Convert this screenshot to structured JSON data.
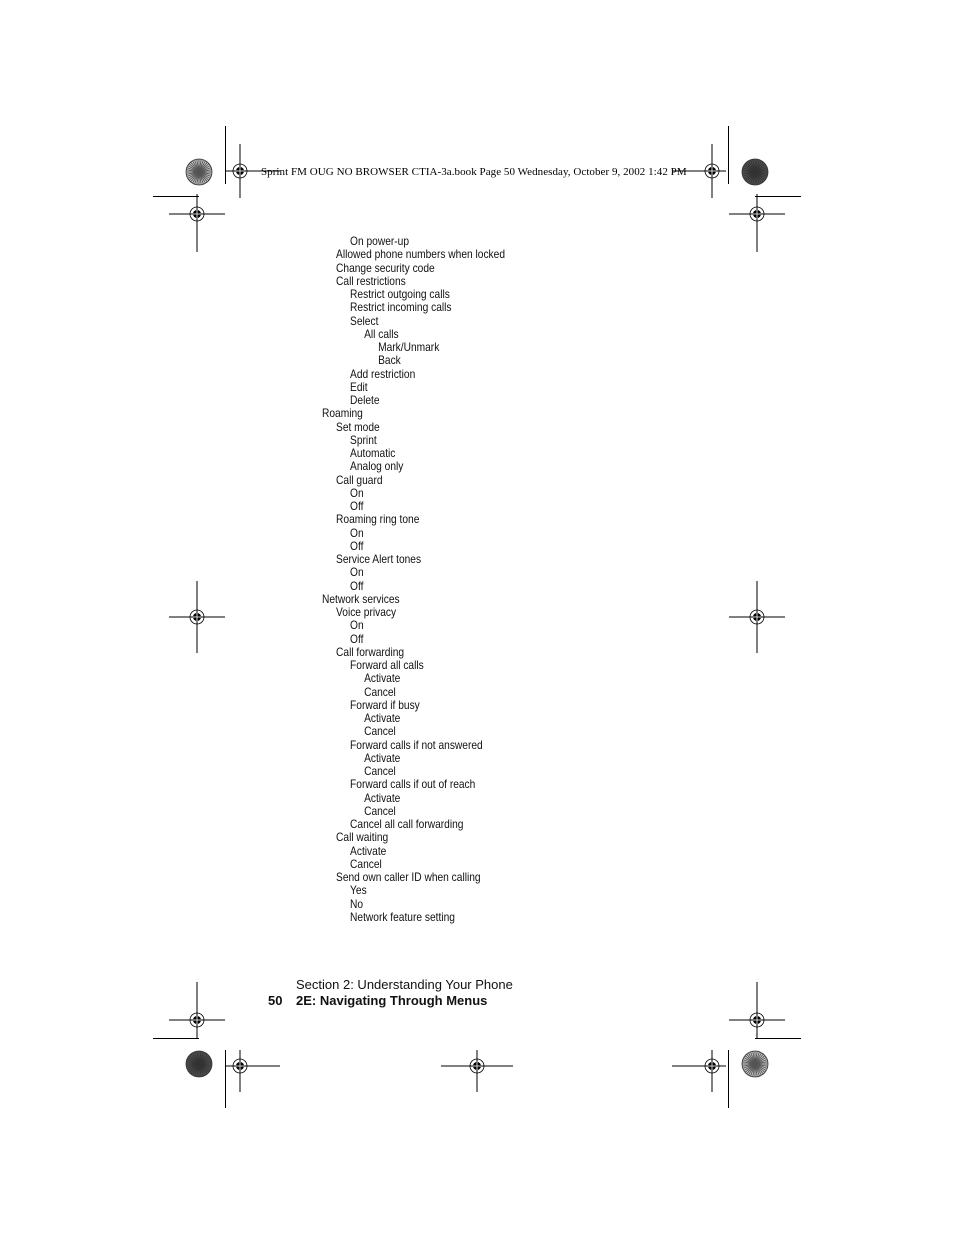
{
  "header": {
    "slug": "Sprint FM OUG NO BROWSER CTIA-3a.book  Page 50  Wednesday, October 9, 2002  1:42 PM"
  },
  "menu": [
    {
      "label": "On power-up",
      "level": 2
    },
    {
      "label": "Allowed phone numbers when locked",
      "level": 1
    },
    {
      "label": "Change security code",
      "level": 1
    },
    {
      "label": "Call restrictions",
      "level": 1
    },
    {
      "label": "Restrict outgoing calls",
      "level": 2
    },
    {
      "label": "Restrict incoming calls",
      "level": 2
    },
    {
      "label": "Select",
      "level": 2
    },
    {
      "label": "All calls",
      "level": 3
    },
    {
      "label": "Mark/Unmark",
      "level": 4
    },
    {
      "label": "Back",
      "level": 4
    },
    {
      "label": "Add restriction",
      "level": 2
    },
    {
      "label": "Edit",
      "level": 2
    },
    {
      "label": "Delete",
      "level": 2
    },
    {
      "label": "Roaming",
      "level": 0
    },
    {
      "label": "Set mode",
      "level": 1
    },
    {
      "label": "Sprint",
      "level": 2
    },
    {
      "label": "Automatic",
      "level": 2
    },
    {
      "label": "Analog only",
      "level": 2
    },
    {
      "label": "Call guard",
      "level": 1
    },
    {
      "label": "On",
      "level": 2
    },
    {
      "label": "Off",
      "level": 2
    },
    {
      "label": "Roaming ring tone",
      "level": 1
    },
    {
      "label": "On",
      "level": 2
    },
    {
      "label": "Off",
      "level": 2
    },
    {
      "label": "Service Alert tones",
      "level": 1
    },
    {
      "label": "On",
      "level": 2
    },
    {
      "label": "Off",
      "level": 2
    },
    {
      "label": "Network services",
      "level": 0
    },
    {
      "label": "Voice privacy",
      "level": 1
    },
    {
      "label": "On",
      "level": 2
    },
    {
      "label": "Off",
      "level": 2
    },
    {
      "label": "Call forwarding",
      "level": 1
    },
    {
      "label": "Forward all calls",
      "level": 2
    },
    {
      "label": "Activate",
      "level": 3
    },
    {
      "label": "Cancel",
      "level": 3
    },
    {
      "label": "Forward if busy",
      "level": 2
    },
    {
      "label": "Activate",
      "level": 3
    },
    {
      "label": "Cancel",
      "level": 3
    },
    {
      "label": "Forward calls if not answered",
      "level": 2
    },
    {
      "label": "Activate",
      "level": 3
    },
    {
      "label": "Cancel",
      "level": 3
    },
    {
      "label": "Forward calls if out of reach",
      "level": 2
    },
    {
      "label": "Activate",
      "level": 3
    },
    {
      "label": "Cancel",
      "level": 3
    },
    {
      "label": "Cancel all call forwarding",
      "level": 2
    },
    {
      "label": "Call waiting",
      "level": 1
    },
    {
      "label": "Activate",
      "level": 2
    },
    {
      "label": "Cancel",
      "level": 2
    },
    {
      "label": "Send own caller ID when calling",
      "level": 1
    },
    {
      "label": "Yes",
      "level": 2
    },
    {
      "label": "No",
      "level": 2
    },
    {
      "label": "Network feature setting",
      "level": 2
    }
  ],
  "footer": {
    "section": "Section 2: Understanding Your Phone",
    "page_number": "50",
    "chapter": "2E: Navigating Through Menus"
  }
}
